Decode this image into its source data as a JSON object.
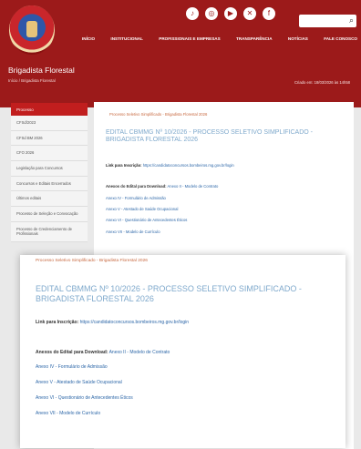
{
  "header": {
    "nav": [
      "INÍCIO",
      "INSTITUCIONAL",
      "PROFISSIONAIS E EMPRESAS",
      "TRANSPARÊNCIA",
      "NOTÍCIAS",
      "FALE CONOSCO"
    ],
    "site_title": "Brigadista Florestal",
    "breadcrumb": "Início / Brigadista Florestal",
    "timestamp": "Criado em: 18/03/2026 às 14h58",
    "search": {
      "placeholder": ""
    },
    "social": [
      "tiktok-icon",
      "instagram-icon",
      "youtube-icon",
      "x-icon",
      "facebook-icon"
    ]
  },
  "sidebar": {
    "active": "Processo",
    "items": [
      "CFSd/2023",
      "CFSd BM 2026",
      "CFO 2026",
      "Legislação para Concursos",
      "Concursos e Editais Encerrados",
      "Últimos editais",
      "Processo de Seleção e Convocação",
      "Processo de Credenciamento de Profissionais"
    ]
  },
  "content": {
    "crumb": "Processo Seletivo Simplificado - Brigadista Florestal 2026",
    "title": "EDITAL CBMMG Nº 10/2026 - PROCESSO SELETIVO SIMPLIFICADO - BRIGADISTA FLORESTAL 2026",
    "link_label": "Link para Inscrição:",
    "link_url": "https://candidatoconcursos.bombeiros.mg.gov.br/login",
    "annex_head_label": "Anexos do Edital para Download:",
    "annex_head_link": "Anexo II - Modelo de Contrato",
    "annexes": [
      "Anexo IV - Formulário de Admissão",
      "Anexo V - Atestado de Saúde Ocupacional",
      "Anexo VI - Questionário de Antecedentes Éticos",
      "Anexo VII - Modelo de Currículo"
    ]
  },
  "overlay": {
    "crumb": "Processo Seletivo Simplificado - Brigadista Florestal 2026",
    "title": "EDITAL CBMMG Nº 10/2026 - PROCESSO SELETIVO SIMPLIFICADO - BRIGADISTA FLORESTAL 2026",
    "link_label": "Link para Inscrição:",
    "link_url": "https://candidatoconcursos.bombeiros.mg.gov.br/login",
    "annex_head_label": "Anexos do Edital para Download:",
    "annex_head_link": "Anexo II - Modelo de Contrato",
    "annexes": [
      "Anexo IV - Formulário de Admissão",
      "Anexo V - Atestado de Saúde Ocupacional",
      "Anexo VI - Questionário de Antecedentes Éticos",
      "Anexo VII - Modelo de Currículo"
    ]
  },
  "colors": {
    "brand_red": "#9c1a1a",
    "active_red": "#c11e1e",
    "title_blue": "#7fa9cc",
    "link_blue": "#2d67a8",
    "crumb_orange": "#c7683f"
  }
}
